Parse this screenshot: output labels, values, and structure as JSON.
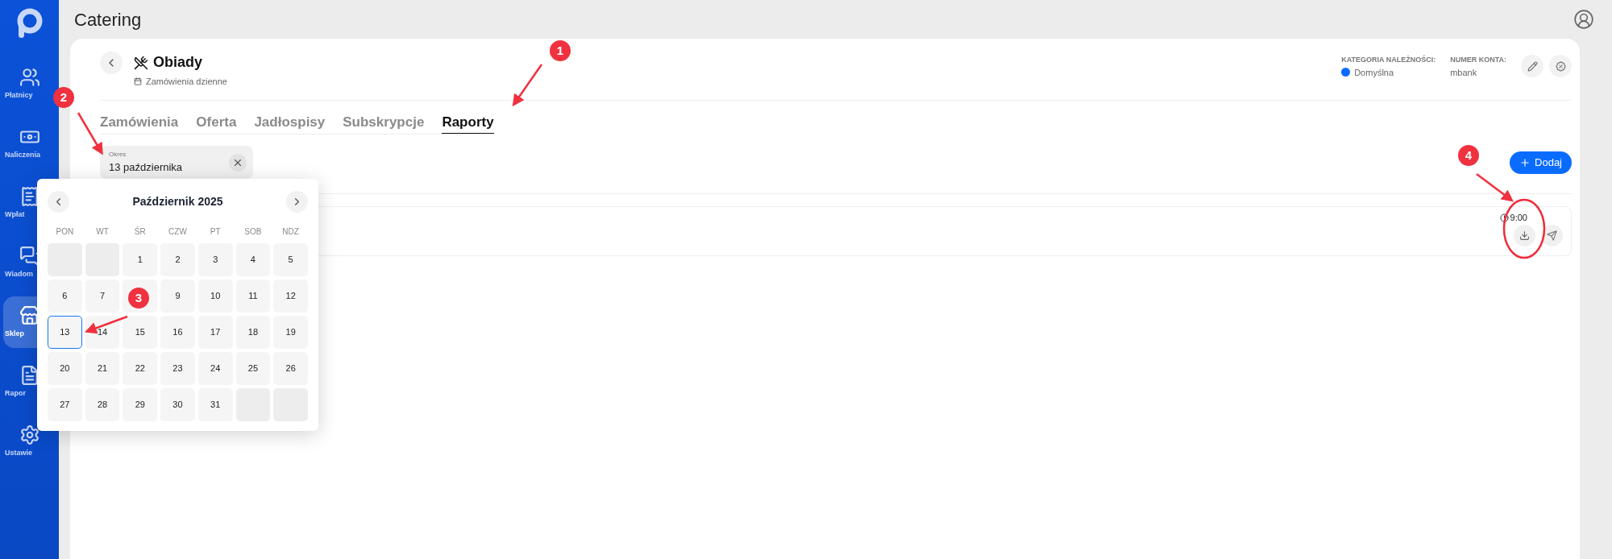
{
  "app": {
    "title": "Catering"
  },
  "sidebar": {
    "items": [
      {
        "label": "Płatnicy",
        "selected": false
      },
      {
        "label": "Naliczenia",
        "selected": false
      },
      {
        "label": "Wpłat",
        "selected": false
      },
      {
        "label": "Wiadom",
        "selected": false
      },
      {
        "label": "Sklep",
        "selected": true
      },
      {
        "label": "Rapor",
        "selected": false
      },
      {
        "label": "Ustawie",
        "selected": false
      }
    ]
  },
  "header": {
    "title": "Obiady",
    "subtitle": "Zamówienia dzienne",
    "category_label": "KATEGORIA NALEŻNOŚCI:",
    "category": {
      "name": "Domyślna",
      "color": "#0a6cff"
    },
    "account_label": "NUMER KONTA:",
    "account": "mbank"
  },
  "tabs": [
    {
      "label": "Zamówienia",
      "selected": false
    },
    {
      "label": "Oferta",
      "selected": false
    },
    {
      "label": "Jadłospisy",
      "selected": false
    },
    {
      "label": "Subskrypcje",
      "selected": false
    },
    {
      "label": "Raporty",
      "selected": true
    }
  ],
  "period_field": {
    "label": "Okres",
    "value": "13 października"
  },
  "add_button": {
    "label": "Dodaj"
  },
  "report_row": {
    "time": "9:00"
  },
  "calendar": {
    "title": "Październik 2025",
    "weekdays": [
      "PON",
      "WT",
      "ŚR",
      "CZW",
      "PT",
      "SOB",
      "NDZ"
    ],
    "days": [
      {
        "kind": "empty"
      },
      {
        "kind": "empty"
      },
      {
        "kind": "day",
        "label": "1",
        "selected": false
      },
      {
        "kind": "day",
        "label": "2",
        "selected": false
      },
      {
        "kind": "day",
        "label": "3",
        "selected": false
      },
      {
        "kind": "day",
        "label": "4",
        "selected": false
      },
      {
        "kind": "day",
        "label": "5",
        "selected": false
      },
      {
        "kind": "day",
        "label": "6",
        "selected": false
      },
      {
        "kind": "day",
        "label": "7",
        "selected": false
      },
      {
        "kind": "covered",
        "selected": false
      },
      {
        "kind": "day",
        "label": "9",
        "selected": false
      },
      {
        "kind": "day",
        "label": "10",
        "selected": false
      },
      {
        "kind": "day",
        "label": "11",
        "selected": false
      },
      {
        "kind": "day",
        "label": "12",
        "selected": false
      },
      {
        "kind": "day",
        "label": "13",
        "selected": true
      },
      {
        "kind": "day",
        "label": "14",
        "selected": false
      },
      {
        "kind": "day",
        "label": "15",
        "selected": false
      },
      {
        "kind": "day",
        "label": "16",
        "selected": false
      },
      {
        "kind": "day",
        "label": "17",
        "selected": false
      },
      {
        "kind": "day",
        "label": "18",
        "selected": false
      },
      {
        "kind": "day",
        "label": "19",
        "selected": false
      },
      {
        "kind": "day",
        "label": "20",
        "selected": false
      },
      {
        "kind": "day",
        "label": "21",
        "selected": false
      },
      {
        "kind": "day",
        "label": "22",
        "selected": false
      },
      {
        "kind": "day",
        "label": "23",
        "selected": false
      },
      {
        "kind": "day",
        "label": "24",
        "selected": false
      },
      {
        "kind": "day",
        "label": "25",
        "selected": false
      },
      {
        "kind": "day",
        "label": "26",
        "selected": false
      },
      {
        "kind": "day",
        "label": "27",
        "selected": false
      },
      {
        "kind": "day",
        "label": "28",
        "selected": false
      },
      {
        "kind": "day",
        "label": "29",
        "selected": false
      },
      {
        "kind": "day",
        "label": "30",
        "selected": false
      },
      {
        "kind": "day",
        "label": "31",
        "selected": false
      },
      {
        "kind": "empty"
      },
      {
        "kind": "empty"
      }
    ]
  },
  "annotations": [
    {
      "label": "1"
    },
    {
      "label": "2"
    },
    {
      "label": "3"
    },
    {
      "label": "4"
    }
  ]
}
